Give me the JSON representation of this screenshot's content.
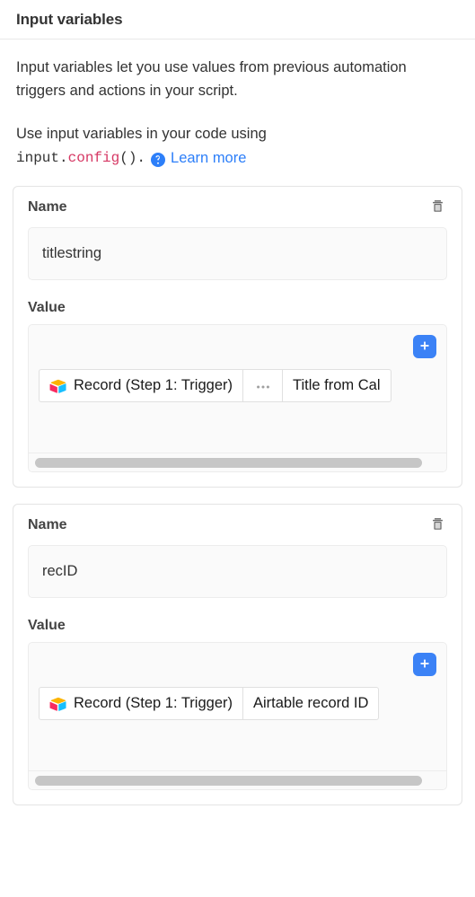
{
  "header": {
    "title": "Input variables"
  },
  "intro": {
    "paragraph1": "Input variables let you use values from previous automation triggers and actions in your script.",
    "paragraph2_prefix": "Use input variables in your code using",
    "code_obj": "input.",
    "code_fn": "config",
    "code_suffix": "().",
    "help_icon": "question-circle-icon",
    "learn_more_label": "Learn more",
    "link_color": "#2d7ff9",
    "code_accent_color": "#d63864"
  },
  "variables": [
    {
      "name_label": "Name",
      "name_value": "titlestring",
      "name_placeholder": "Name",
      "value_label": "Value",
      "delete_icon": "trash-icon",
      "add_icon": "plus-icon",
      "add_button_color": "#3b82f6",
      "token": {
        "source_icon": "airtable-record-icon",
        "source_label": "Record (Step 1: Trigger)",
        "more_icon": "ellipsis-icon",
        "field_label": "Title from Cal",
        "field_truncated": true
      },
      "scrollbar": {
        "thumb_ratio": 0.955,
        "thumb_color": "#c6c6c6"
      }
    },
    {
      "name_label": "Name",
      "name_value": "recID",
      "name_placeholder": "Name",
      "value_label": "Value",
      "delete_icon": "trash-icon",
      "add_icon": "plus-icon",
      "add_button_color": "#3b82f6",
      "token": {
        "source_icon": "airtable-record-icon",
        "source_label": "Record (Step 1: Trigger)",
        "more_icon": "",
        "field_label": "Airtable record ID",
        "field_truncated": false
      },
      "scrollbar": {
        "thumb_ratio": 0.955,
        "thumb_color": "#c6c6c6"
      }
    }
  ]
}
